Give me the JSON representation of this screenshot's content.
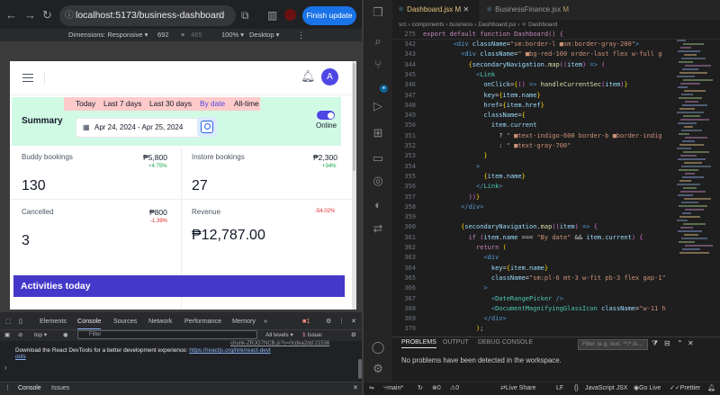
{
  "browser": {
    "url": "localhost:5173/business-dashboard",
    "finish_update": "Finish update",
    "device_toolbar": {
      "dimensions": "Dimensions: Responsive ▾",
      "width": "692",
      "times": "×",
      "height": "485",
      "zoom": "100% ▾",
      "device": "Desktop ▾"
    }
  },
  "app": {
    "avatar_letter": "A",
    "range_tabs": [
      "Today",
      "Last 7 days",
      "Last 30 days",
      "By date",
      "All-time"
    ],
    "active_range": "By date",
    "summary_label": "Summary",
    "date_range": "Apr 24, 2024 - Apr 25, 2024",
    "toggle_label": "Online",
    "toggle_on": true,
    "cards": [
      {
        "label": "Buddy bookings",
        "value": "₱5,800",
        "change": "+4.75%",
        "big": "130",
        "trend": "up"
      },
      {
        "label": "Instore bookings",
        "value": "₱2,300",
        "change": "+34%",
        "big": "27",
        "trend": "up"
      },
      {
        "label": "Cancelled",
        "value": "₱800",
        "change": "-1.39%",
        "big": "3",
        "trend": "down"
      },
      {
        "label": "Revenue",
        "value": "",
        "change": "-54.02%",
        "big": "₱12,787.00",
        "trend": "down"
      }
    ],
    "activities_title": "Activities today"
  },
  "devtools": {
    "tabs": [
      "Elements",
      "Console",
      "Sources",
      "Network",
      "Performance",
      "Memory"
    ],
    "active_tab": "Console",
    "issue_badge": "1",
    "context": "top ▾",
    "filter_placeholder": "Filter",
    "levels": "All levels ▾",
    "issues": "1 Issue:",
    "issues_count": "1",
    "message_text": "Download the React DevTools for a better development experience: ",
    "message_link": "https://reactjs.org/link/react-devt",
    "message_link2": "ools",
    "message_source": "chunk-ZRJG7NCB.js?v=0cdea2dd:21536",
    "prompt": "›",
    "bottom_tabs": [
      "Console",
      "Issues"
    ]
  },
  "vscode": {
    "tabs": [
      {
        "name": "Dashboard.jsx",
        "badge": "M",
        "active": true
      },
      {
        "name": "BusinessFinance.jsx",
        "badge": "M",
        "active": false
      }
    ],
    "breadcrumb": "src  ›  components  ›  business  ›  Dashboard.jsx  ›  ⚛ Dashboard",
    "sticky": {
      "num": "275",
      "text": "export default function Dashboard() {"
    },
    "lines": [
      {
        "n": "342",
        "html": "        <span class='b'>&lt;div</span> <span class='a'>className</span>=<span class='s'>\"sm:border-l ■sm:border-gray-200\"</span><span class='b'>&gt;</span>"
      },
      {
        "n": "343",
        "html": "          <span class='b'>&lt;div</span> <span class='a'>className</span>=<span class='s'>\" ■bg-red-100 order-last flex w-full g</span>"
      },
      {
        "n": "344",
        "html": "            <span class='y'>{</span><span class='a'>secondaryNavigation</span>.<span class='f'>map</span><span class='p'>((</span><span class='a'>item</span><span class='p'>)</span> <span class='b'>=&gt;</span> <span class='p'>(</span>"
      },
      {
        "n": "345",
        "html": "              <span class='b'>&lt;</span><span class='t'>Link</span>"
      },
      {
        "n": "346",
        "html": "                <span class='a'>onClick</span>=<span class='y'>{</span><span class='p'>()</span> <span class='b'>=&gt;</span> <span class='f'>handleCurrentSec</span><span class='p'>(</span><span class='a'>item</span><span class='p'>)</span><span class='y'>}</span>"
      },
      {
        "n": "347",
        "html": "                <span class='a'>key</span>=<span class='y'>{</span><span class='a'>item</span>.<span class='a'>name</span><span class='y'>}</span>"
      },
      {
        "n": "348",
        "html": "                <span class='a'>href</span>=<span class='y'>{</span><span class='a'>item</span>.<span class='a'>href</span><span class='y'>}</span>"
      },
      {
        "n": "349",
        "html": "                <span class='a'>className</span>=<span class='y'>{</span>"
      },
      {
        "n": "350",
        "html": "                  <span class='a'>item</span>.<span class='a'>current</span>"
      },
      {
        "n": "351",
        "html": "                    ? <span class='s'>\" ■text-indigo-600 border-b ■border-indig</span>"
      },
      {
        "n": "352",
        "html": "                    : <span class='s'>\" ■text-gray-700\"</span>"
      },
      {
        "n": "353",
        "html": "                <span class='y'>}</span>"
      },
      {
        "n": "354",
        "html": "              <span class='b'>&gt;</span>"
      },
      {
        "n": "355",
        "html": "                <span class='y'>{</span><span class='a'>item</span>.<span class='a'>name</span><span class='y'>}</span>"
      },
      {
        "n": "356",
        "html": "              <span class='b'>&lt;/</span><span class='t'>Link</span><span class='b'>&gt;</span>"
      },
      {
        "n": "357",
        "html": "            <span class='p'>))</span><span class='y'>}</span>"
      },
      {
        "n": "358",
        "html": "          <span class='b'>&lt;/div&gt;</span>"
      },
      {
        "n": "359",
        "html": ""
      },
      {
        "n": "360",
        "html": "          <span class='y'>{</span><span class='a'>secondaryNavigation</span>.<span class='f'>map</span><span class='p'>((</span><span class='a'>item</span><span class='p'>)</span> <span class='b'>=&gt;</span> <span class='p'>{</span>"
      },
      {
        "n": "361",
        "html": "            <span class='k'>if</span> <span class='p'>(</span><span class='a'>item</span>.<span class='a'>name</span> === <span class='s'>\"By date\"</span> &amp;&amp; <span class='a'>item</span>.<span class='a'>current</span><span class='p'>)</span> <span class='p'>{</span>"
      },
      {
        "n": "362",
        "html": "              <span class='k'>return</span> <span class='y'>(</span>"
      },
      {
        "n": "363",
        "html": "                <span class='b'>&lt;div</span>"
      },
      {
        "n": "364",
        "html": "                  <span class='a'>key</span>=<span class='y'>{</span><span class='a'>item</span>.<span class='a'>name</span><span class='y'>}</span>"
      },
      {
        "n": "365",
        "html": "                  <span class='a'>className</span>=<span class='s'>\"sm:pl-6 mt-3 w-fit pb-3 flex gap-1\"</span>"
      },
      {
        "n": "366",
        "html": "                <span class='b'>&gt;</span>"
      },
      {
        "n": "367",
        "html": "                  <span class='b'>&lt;</span><span class='t'>DateRangePicker</span> <span class='b'>/&gt;</span>"
      },
      {
        "n": "368",
        "html": "                  <span class='b'>&lt;</span><span class='t'>DocumentMagnifyingGlassIcon</span> <span class='a'>className</span>=<span class='s'>\"w-11 h</span>"
      },
      {
        "n": "369",
        "html": "                <span class='b'>&lt;/div&gt;</span>"
      },
      {
        "n": "370",
        "html": "              <span class='y'>)</span>;"
      },
      {
        "n": "371",
        "html": "            <span class='p'>}</span>"
      }
    ],
    "panel": {
      "tabs": [
        "PROBLEMS",
        "OUTPUT",
        "DEBUG CONSOLE"
      ],
      "active_tab": "PROBLEMS",
      "filter_placeholder": "Filter (e.g. text, **/*.ts...",
      "message": "No problems have been detected in the workspace."
    },
    "status": {
      "branch": "main*",
      "live_share": "Live Share",
      "encoding": "LF",
      "language": "JavaScript JSX",
      "go_live": "Go Live",
      "prettier": "Prettier",
      "errors": "0",
      "warnings": "0"
    }
  },
  "colors": {
    "accent": "#4f46e5",
    "green": "#16a34a",
    "red": "#dc2626",
    "summary_bg": "#d1fae5",
    "ranges_bg": "#fecaca"
  }
}
